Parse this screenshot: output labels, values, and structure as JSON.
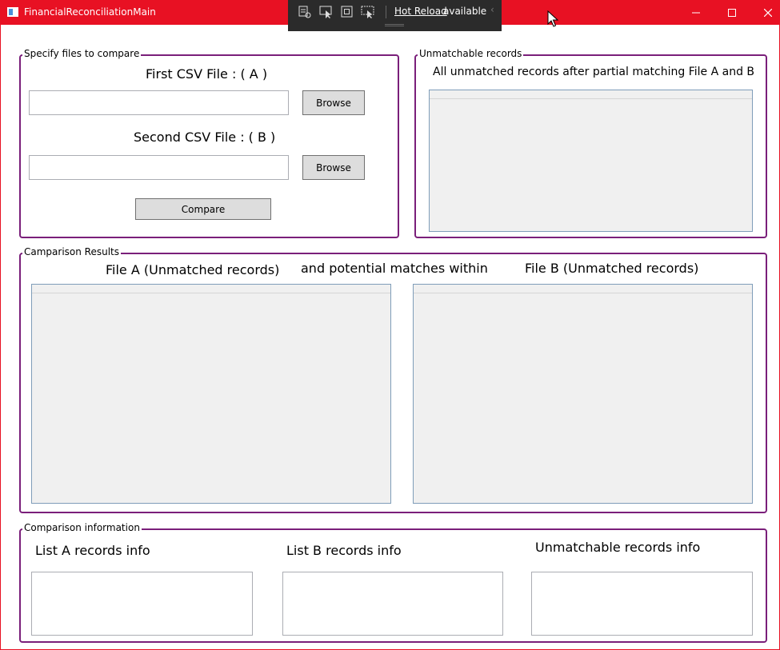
{
  "window": {
    "title": "FinancialReconciliationMain"
  },
  "hot_reload": {
    "link": "Hot Reload",
    "text": "available",
    "icons": [
      "live-visual-tree-icon",
      "select-element-icon",
      "display-layout-adorners-icon",
      "track-focus-icon"
    ]
  },
  "files_group": {
    "legend": "Specify files to compare",
    "first_label": "First CSV File : ( A )",
    "first_value": "",
    "first_browse": "Browse",
    "second_label": "Second CSV File : ( B )",
    "second_value": "",
    "second_browse": "Browse",
    "compare": "Compare"
  },
  "unmatchable_group": {
    "legend": "Unmatchable records",
    "description": "All unmatched records after partial matching File A and B"
  },
  "results_group": {
    "legend": "Camparison Results",
    "file_a_heading": "File A (Unmatched records)",
    "middle_heading": "and potential matches within",
    "file_b_heading": "File B (Unmatched records)"
  },
  "info_group": {
    "legend": "Comparison information",
    "list_a_label": "List A records info",
    "list_b_label": "List B records info",
    "unmatchable_label": "Unmatchable records info"
  },
  "colors": {
    "titlebar": "#e81123",
    "group_border": "#7a1f7a",
    "toolbar": "#2b2b2b"
  }
}
